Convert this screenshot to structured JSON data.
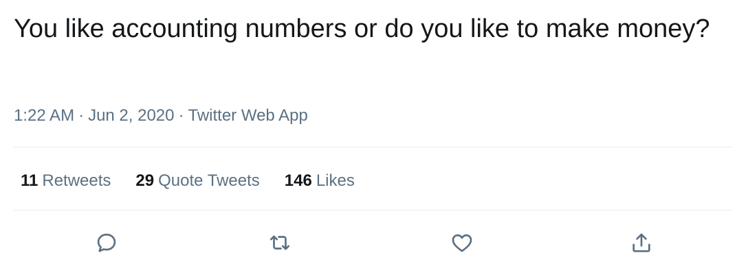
{
  "tweet": {
    "text": "You like accounting numbers or do you like to make money?",
    "meta": {
      "time": "1:22 AM",
      "separator": "·",
      "date": "Jun 2, 2020",
      "source": "Twitter Web App"
    },
    "stats": [
      {
        "count": "11",
        "label": "Retweets"
      },
      {
        "count": "29",
        "label": "Quote Tweets"
      },
      {
        "count": "146",
        "label": "Likes"
      }
    ],
    "actions": [
      {
        "icon": "reply-icon"
      },
      {
        "icon": "retweet-icon"
      },
      {
        "icon": "like-heart-icon"
      },
      {
        "icon": "share-icon"
      }
    ]
  },
  "colors": {
    "text": "#14171a",
    "secondary": "#5b7083",
    "divider": "#e6ecf0"
  }
}
